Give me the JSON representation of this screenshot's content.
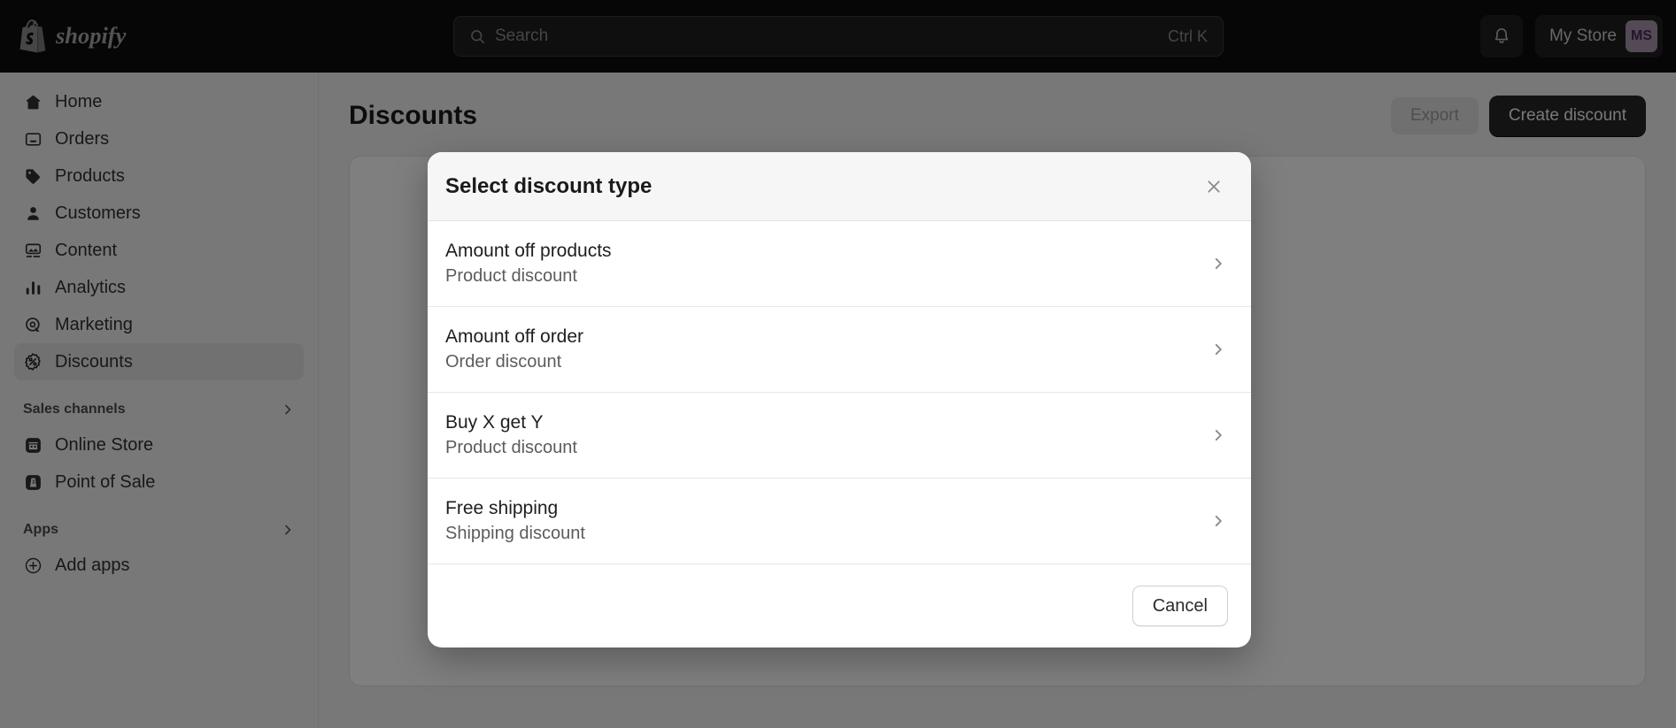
{
  "topbar": {
    "logo_name": "shopify",
    "search": {
      "placeholder": "Search",
      "shortcut": "Ctrl K",
      "value": ""
    },
    "notifications_label": "Notifications",
    "store_name": "My Store",
    "avatar_initials": "MS"
  },
  "sidebar": {
    "items": [
      {
        "label": "Home",
        "icon": "home-icon",
        "active": false
      },
      {
        "label": "Orders",
        "icon": "orders-icon",
        "active": false
      },
      {
        "label": "Products",
        "icon": "products-icon",
        "active": false
      },
      {
        "label": "Customers",
        "icon": "customers-icon",
        "active": false
      },
      {
        "label": "Content",
        "icon": "content-icon",
        "active": false
      },
      {
        "label": "Analytics",
        "icon": "analytics-icon",
        "active": false
      },
      {
        "label": "Marketing",
        "icon": "marketing-icon",
        "active": false
      },
      {
        "label": "Discounts",
        "icon": "discounts-icon",
        "active": true
      }
    ],
    "sections": [
      {
        "title": "Sales channels",
        "items": [
          {
            "label": "Online Store",
            "icon": "storefront-icon"
          },
          {
            "label": "Point of Sale",
            "icon": "pos-icon"
          }
        ]
      },
      {
        "title": "Apps",
        "items": [
          {
            "label": "Add apps",
            "icon": "plus-circle-icon"
          }
        ]
      }
    ]
  },
  "main": {
    "page_title": "Discounts",
    "export_label": "Export",
    "create_label": "Create discount",
    "card_cta_label": ""
  },
  "modal": {
    "title": "Select discount type",
    "close_label": "Close",
    "options": [
      {
        "title": "Amount off products",
        "subtitle": "Product discount"
      },
      {
        "title": "Amount off order",
        "subtitle": "Order discount"
      },
      {
        "title": "Buy X get Y",
        "subtitle": "Product discount"
      },
      {
        "title": "Free shipping",
        "subtitle": "Shipping discount"
      }
    ],
    "cancel_label": "Cancel"
  },
  "colors": {
    "topbar_bg": "#0d0d0d",
    "accent_avatar": "#a694ab",
    "primary_button": "#262626",
    "app_bg": "#f1f1f1",
    "active_nav": "#e3e3e3"
  }
}
